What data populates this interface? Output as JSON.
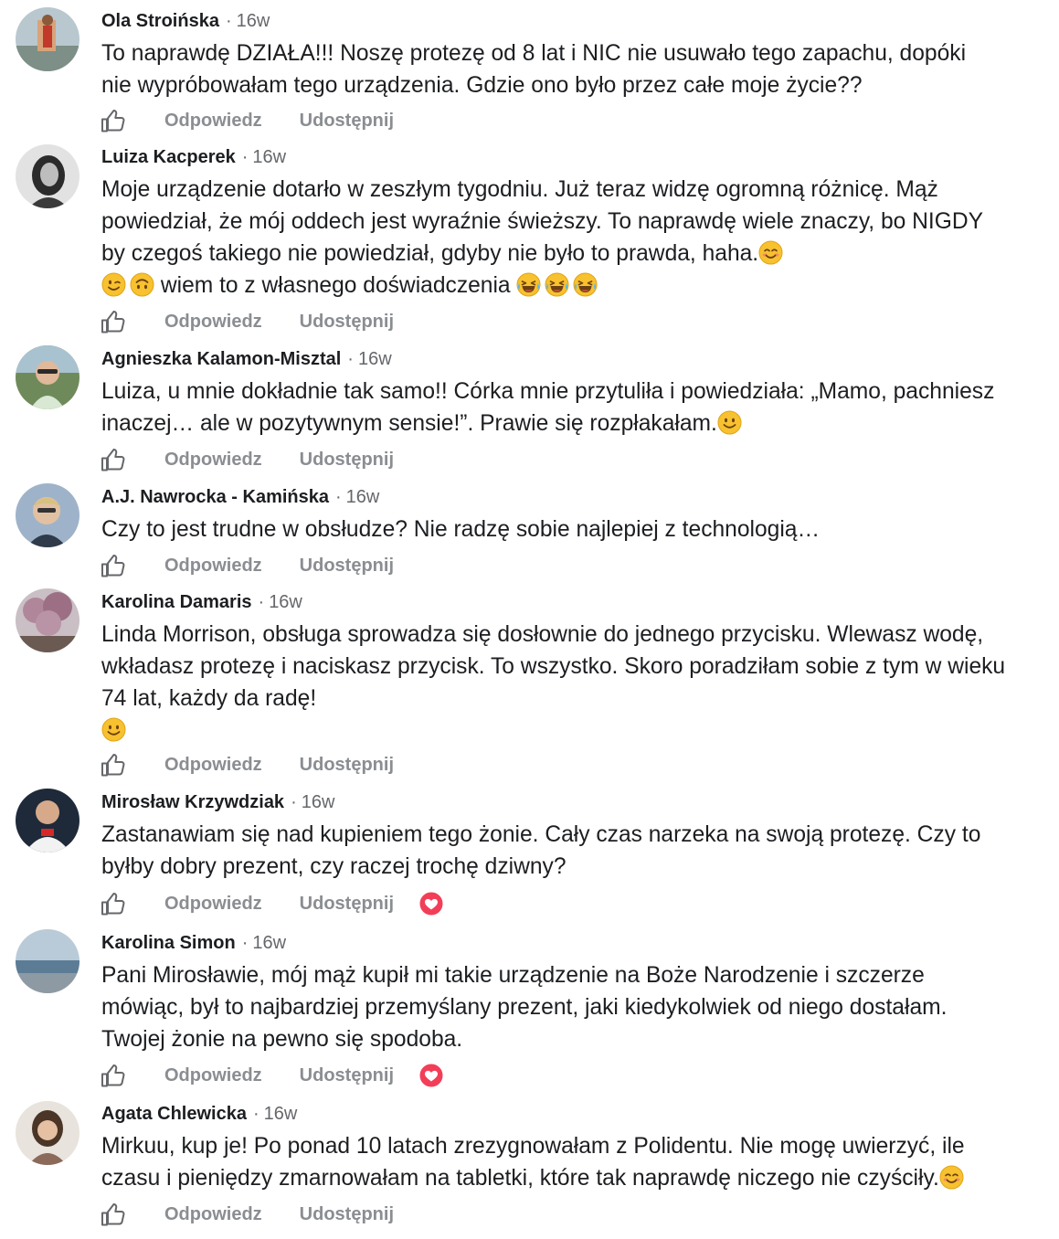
{
  "actions": {
    "reply_label": "Odpowiedz",
    "share_label": "Udostępnij"
  },
  "comments": [
    {
      "author": "Ola Stroińska",
      "time": "16w",
      "text": "To naprawdę DZIAŁA!!! Noszę protezę od 8 lat i NIC nie usuwało tego zapachu, dopóki\nnie wypróbowałam tego urządzenia. Gdzie ono było przez całe moje życie??"
    },
    {
      "author": "Luiza Kacperek",
      "time": "16w",
      "text": "Moje urządzenie dotarło w zeszłym tygodniu. Już teraz widzę ogromną różnicę. Mąż\npowiedział, że mój oddech jest wyraźnie świeższy. To naprawdę wiele znaczy, bo NIGDY\nby czegoś takiego nie powiedział, gdyby nie było to prawda, haha.",
      "text_line2": "wiem to z własnego doświadczenia"
    },
    {
      "author": "Agnieszka Kalamon-Misztal",
      "time": "16w",
      "text": "Luiza, u mnie dokładnie tak samo!! Córka mnie przytuliła i powiedziała: „Mamo, pachniesz\ninaczej… ale w pozytywnym sensie!”. Prawie się rozpłakałam."
    },
    {
      "author": "A.J. Nawrocka - Kamińska",
      "time": "16w",
      "text": "Czy to jest trudne w obsłudze? Nie radzę sobie najlepiej z technologią…"
    },
    {
      "author": "Karolina Damaris",
      "time": "16w",
      "text": "Linda Morrison, obsługa sprowadza się dosłownie do jednego przycisku. Wlewasz wodę,\nwkładasz protezę i naciskasz przycisk. To wszystko. Skoro poradziłam sobie z tym w wieku\n74 lat, każdy da radę!"
    },
    {
      "author": "Mirosław Krzywdziak",
      "time": "16w",
      "text": "Zastanawiam się nad kupieniem tego żonie. Cały czas narzeka na swoją protezę. Czy to\nbyłby dobry prezent, czy raczej trochę dziwny?"
    },
    {
      "author": "Karolina Simon",
      "time": "16w",
      "text": "Pani Mirosławie, mój mąż kupił mi takie urządzenie na Boże Narodzenie i szczerze\nmówiąc, był to najbardziej przemyślany prezent, jaki kiedykolwiek od niego dostałam.\nTwojej żonie na pewno się spodoba."
    },
    {
      "author": "Agata Chlewicka",
      "time": "16w",
      "text": "Mirkuu, kup je! Po ponad 10 latach zrezygnowałam z Polidentu. Nie mogę uwierzyć, ile\nczasu i pieniędzy zmarnowałam na tabletki, które tak naprawdę niczego nie czyściły."
    }
  ],
  "colors": {
    "text": "#1c1e21",
    "secondary": "#65676b",
    "action": "#8a8d91",
    "heart": "#f33e58",
    "emoji": "#f7c12f"
  }
}
